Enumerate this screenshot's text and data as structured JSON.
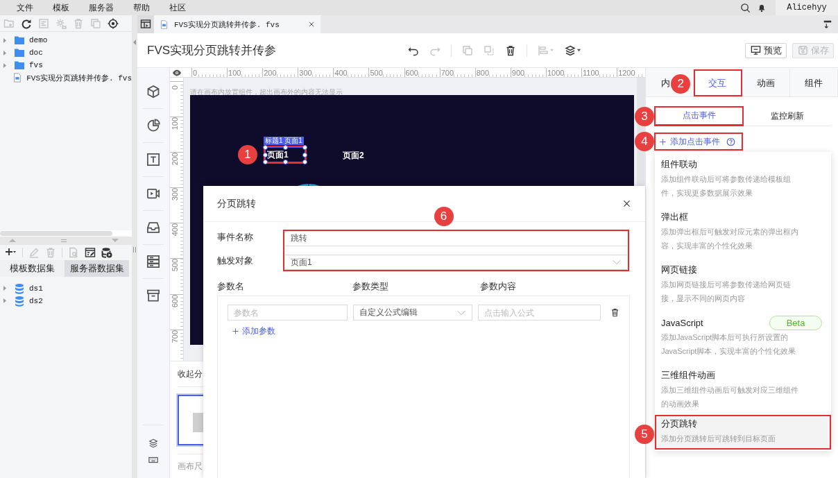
{
  "menubar": {
    "items": [
      "文件",
      "模板",
      "服务器",
      "帮助",
      "社区"
    ],
    "user": "Alicehyy"
  },
  "left_panel": {
    "toolbar": [
      {
        "kind": "new-folder",
        "disabled": true
      },
      {
        "kind": "refresh",
        "disabled": false
      },
      {
        "kind": "file-info",
        "disabled": true
      },
      {
        "kind": "settings",
        "disabled": true
      },
      {
        "kind": "delete",
        "disabled": true
      },
      {
        "kind": "copy",
        "disabled": true
      },
      {
        "kind": "locate",
        "disabled": false
      }
    ],
    "tree": [
      {
        "label": "demo",
        "kind": "folder"
      },
      {
        "label": "doc",
        "kind": "folder"
      },
      {
        "label": "fvs",
        "kind": "folder"
      },
      {
        "label": "FVS实现分页跳转并传参. fvs",
        "kind": "file"
      }
    ],
    "dataset_toolbar": [
      {
        "kind": "add",
        "disabled": false
      },
      {
        "kind": "edit",
        "disabled": true
      },
      {
        "kind": "delete",
        "disabled": true
      },
      {
        "kind": "preview",
        "disabled": true
      },
      {
        "kind": "edit-db",
        "disabled": false
      },
      {
        "kind": "db-run",
        "disabled": false
      }
    ],
    "dataset_tabs": [
      {
        "label": "模板数据集",
        "selected": true
      },
      {
        "label": "服务器数据集",
        "selected": false
      }
    ],
    "datasets": [
      {
        "label": "ds1"
      },
      {
        "label": "ds2"
      }
    ]
  },
  "doc_tabs": [
    {
      "label": "FVS实现分页跳转并传参. fvs",
      "selected": true
    }
  ],
  "header": {
    "title": "FVS实现分页跳转并传参",
    "toolbar": [
      {
        "kind": "undo",
        "disabled": false
      },
      {
        "kind": "redo",
        "disabled": true
      },
      {
        "kind": "copy",
        "disabled": true
      },
      {
        "kind": "paste",
        "disabled": true
      },
      {
        "kind": "delete",
        "disabled": false
      },
      {
        "kind": "align",
        "disabled": true
      },
      {
        "kind": "layers",
        "disabled": false
      }
    ],
    "buttons": [
      {
        "label": "预览",
        "kind": "preview",
        "disabled": false
      },
      {
        "label": "保存",
        "kind": "save",
        "disabled": true
      }
    ]
  },
  "ruler": {
    "x_labels": [
      "0",
      "100",
      "200",
      "300",
      "400",
      "500",
      "600",
      "700",
      "800",
      "900",
      "1000",
      "1100",
      "1200"
    ],
    "y_labels": [
      "0",
      "100",
      "200",
      "300",
      "400",
      "500",
      "600",
      "700"
    ]
  },
  "canvas": {
    "hint": "请在画布内放置组件，超出画布外的内容无法显示",
    "elements": [
      {
        "kind": "page_tab",
        "label": "页面1",
        "tag": "标题1 页面1",
        "selected": true,
        "outlined": true,
        "callout": "1"
      },
      {
        "kind": "page_tab",
        "label": "页面2",
        "selected": false,
        "outlined": false
      },
      {
        "kind": "chart"
      }
    ]
  },
  "bottom": {
    "collapse_label": "收起分",
    "size_label": "画布尺"
  },
  "dialog": {
    "title": "分页跳转",
    "callout": "6",
    "fields_outlined": true,
    "fields": [
      {
        "label": "事件名称",
        "kind": "text",
        "value": "跳转"
      },
      {
        "label": "触发对象",
        "kind": "select",
        "value": "页面1"
      }
    ],
    "param_columns": [
      "参数名",
      "参数类型",
      "参数内容"
    ],
    "params": [
      {
        "name_placeholder": "参数名",
        "type": "自定义公式编辑",
        "content_placeholder": "点击输入公式"
      }
    ],
    "add_param": "添加参数"
  },
  "right_panel": {
    "tabs": [
      {
        "label": "内",
        "selected": false,
        "outlined": false
      },
      {
        "label": "交互",
        "selected": true,
        "outlined": true,
        "callout": "2"
      },
      {
        "label": "动画",
        "selected": false,
        "outlined": false
      },
      {
        "label": "组件",
        "selected": false,
        "outlined": false
      }
    ],
    "subtabs": [
      {
        "label": "点击事件",
        "selected": true,
        "outlined": true,
        "callout": "3"
      },
      {
        "label": "监控刷新",
        "selected": false,
        "outlined": false
      }
    ],
    "add_event": {
      "label": "添加点击事件",
      "outlined": true,
      "callout": "4"
    },
    "menu": [
      {
        "title": "组件联动",
        "description": "添加组件联动后可将参数传递给模板组件，实现更多数据展示效果",
        "selected": false,
        "outlined": false
      },
      {
        "title": "弹出框",
        "description": "添加弹出框后可触发对应元素的弹出框内容，实现丰富的个性化效果",
        "selected": false,
        "outlined": false
      },
      {
        "title": "网页链接",
        "description": "添加网页链接后可将参数传递给网页链接，显示不同的网页内容",
        "selected": false,
        "outlined": false
      },
      {
        "title": "JavaScript",
        "badge": "Beta",
        "description": "添加JavaScript脚本后可执行所设置的JavaScript脚本，实现丰富的个性化效果",
        "selected": false,
        "outlined": false
      },
      {
        "title": "三维组件动画",
        "description": "添加三维组件动画后可触发对应三维组件的动画效果",
        "selected": false,
        "outlined": false
      },
      {
        "title": "分页跳转",
        "description": "添加分页跳转后可跳转到目标页面",
        "selected": true,
        "outlined": true,
        "callout": "5"
      }
    ]
  }
}
